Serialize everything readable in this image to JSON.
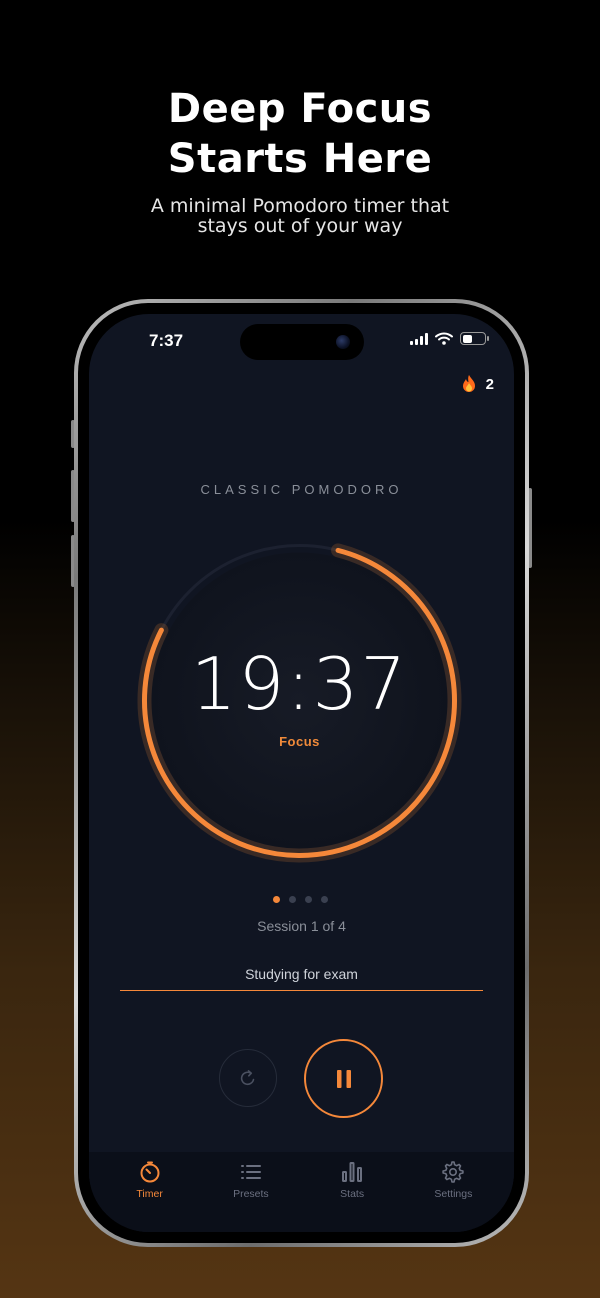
{
  "promo": {
    "title_line1": "Deep Focus",
    "title_line2": "Starts Here",
    "subtitle_line1": "A minimal Pomodoro timer that",
    "subtitle_line2": "stays out of your way"
  },
  "status_bar": {
    "time": "7:37"
  },
  "streak": {
    "icon": "fire-icon",
    "count": "2"
  },
  "timer": {
    "preset_name": "CLASSIC POMODORO",
    "time": "19:37",
    "phase": "Focus",
    "remaining_fraction": 0.785,
    "session_text": "Session 1 of 4",
    "sessions_total": 4,
    "session_current": 1
  },
  "task": {
    "label": "Studying for exam"
  },
  "controls": {
    "reset_icon": "reset-icon",
    "pause_icon": "pause-icon"
  },
  "tabs": [
    {
      "label": "Timer",
      "icon": "timer-icon",
      "active": true
    },
    {
      "label": "Presets",
      "icon": "list-icon",
      "active": false
    },
    {
      "label": "Stats",
      "icon": "bar-chart-icon",
      "active": false
    },
    {
      "label": "Settings",
      "icon": "gear-icon",
      "active": false
    }
  ],
  "colors": {
    "accent": "#f5883a",
    "screen_bg": "#101522"
  }
}
